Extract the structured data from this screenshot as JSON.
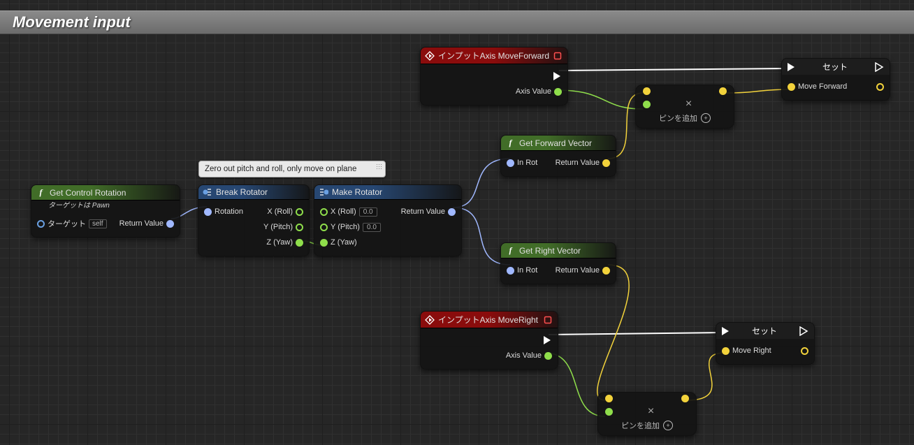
{
  "title": "Movement input",
  "comment": "Zero out pitch and roll, only move on plane",
  "nodes": {
    "get_control_rotation": {
      "title": "Get Control Rotation",
      "subtitle": "ターゲットは Pawn",
      "target_label": "ターゲット",
      "self_label": "self",
      "return_label": "Return Value"
    },
    "break_rotator": {
      "title": "Break Rotator",
      "rotation": "Rotation",
      "x": "X (Roll)",
      "y": "Y (Pitch)",
      "z": "Z (Yaw)"
    },
    "make_rotator": {
      "title": "Make Rotator",
      "x": "X (Roll)",
      "y": "Y (Pitch)",
      "z": "Z (Yaw)",
      "xval": "0.0",
      "yval": "0.0",
      "return_label": "Return Value"
    },
    "input_move_forward": {
      "title": "インプットAxis MoveForward",
      "axis_value": "Axis Value"
    },
    "input_move_right": {
      "title": "インプットAxis MoveRight",
      "axis_value": "Axis Value"
    },
    "get_forward_vector": {
      "title": "Get Forward Vector",
      "in_rot": "In Rot",
      "return_label": "Return Value"
    },
    "get_right_vector": {
      "title": "Get Right Vector",
      "in_rot": "In Rot",
      "return_label": "Return Value"
    },
    "multiply": {
      "add_pin": "ピンを追加"
    },
    "set_forward": {
      "title": "セット",
      "var": "Move Forward"
    },
    "set_right": {
      "title": "セット",
      "var": "Move Right"
    }
  }
}
